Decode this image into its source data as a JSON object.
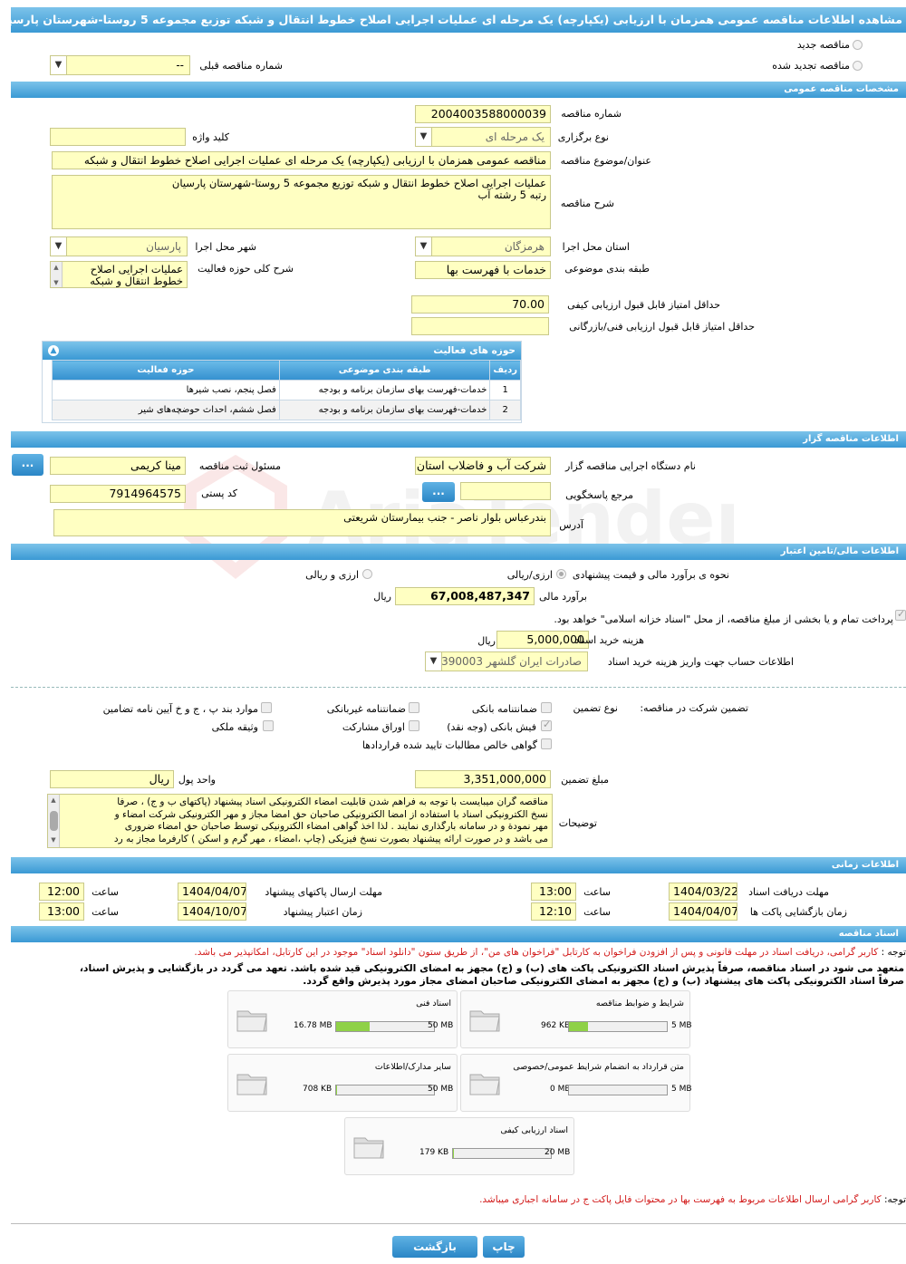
{
  "window_title": "مشاهده اطلاعات مناقصه عمومی همزمان با ارزیابی (یکپارچه) یک مرحله ای عملیات اجرایی اصلاح خطوط انتقال و شبکه توزیع مجموعه 5 روستا-شهرستان پارسیان",
  "top": {
    "new_tender": "مناقصه جدید",
    "renewed_tender": "مناقصه تجدید شده",
    "prev_tender_label": "شماره مناقصه قبلی",
    "prev_tender_value": "--"
  },
  "sections": {
    "general": "مشخصات مناقصه عمومی",
    "organizer": "اطلاعات مناقصه گزار",
    "financial": "اطلاعات مالی/تامین اعتبار",
    "timing": "اطلاعات زمانی",
    "documents": "اسناد مناقصه"
  },
  "general": {
    "tender_no_label": "شماره مناقصه",
    "tender_no": "2004003588000039",
    "type_label": "نوع برگزاری",
    "type": "یک مرحله ای",
    "keyword_label": "کلید واژه",
    "keyword": "",
    "subject_label": "عنوان/موضوع مناقصه",
    "subject": "مناقصه عمومی همزمان با ارزیابی (یکپارچه) یک مرحله ای عملیات اجرایی اصلاح خطوط انتقال و شبکه",
    "desc_label": "شرح مناقصه",
    "desc_line1": "عملیات اجرایی اصلاح خطوط انتقال و شبکه توزیع مجموعه 5 روستا-شهرستان پارسیان",
    "desc_line2": "رتبه 5 رشته آب",
    "province_label": "استان محل اجرا",
    "province": "هرمزگان",
    "city_label": "شهر محل اجرا",
    "city": "پارسیان",
    "category_label": "طبقه بندی موضوعی",
    "category": "خدمات با فهرست بها",
    "activity_label": "شرح کلی حوزه فعالیت",
    "activity_line1": "عملیات اجرایی اصلاح",
    "activity_line2": "خطوط انتقال و شبکه توزیع",
    "min_quality_label": "حداقل امتیاز قابل قبول ارزیابی کیفی",
    "min_quality": "70.00",
    "min_tech_label": "حداقل امتیاز قابل قبول ارزیابی فنی/بازرگانی",
    "min_tech": ""
  },
  "activity_table": {
    "title": "حوزه های فعالیت",
    "headers": [
      "ردیف",
      "طبقه بندی موضوعی",
      "حوزه فعالیت"
    ],
    "rows": [
      [
        "1",
        "خدمات-فهرست بهای سازمان برنامه و بودجه",
        "فصل پنجم، نصب شیرها"
      ],
      [
        "2",
        "خدمات-فهرست بهای سازمان برنامه و بودجه",
        "فصل ششم، احداث حوضچه‌های شیر"
      ]
    ]
  },
  "organizer": {
    "org_label": "نام دستگاه اجرایی مناقصه گزار",
    "org": "شرکت آب و فاضلاب استان",
    "registrar_label": "مسئول ثبت مناقصه",
    "registrar": "مینا کریمی",
    "ref_label": "مرجع پاسخگویی",
    "ref": "",
    "postal_label": "کد پستی",
    "postal": "7914964575",
    "address_label": "آدرس",
    "address": "بندرعباس بلوار ناصر - جنب بیمارستان شریعتی",
    "more_btn": "..."
  },
  "financial": {
    "estimate_type_label": "نحوه ی برآورد مالی و قیمت پیشنهادی",
    "opt_rial": "ارزی/ریالی",
    "opt_fx": "ارزی و ریالی",
    "estimate_label": "برآورد مالی",
    "estimate": "67,008,487,347",
    "unit_rial": "ریال",
    "treasury_text": "پرداخت تمام و یا بخشی از مبلغ مناقصه، از محل \"اسناد خزانه اسلامی\" خواهد بود.",
    "doc_fee_label": "هزینه خرید اسناد",
    "doc_fee": "5,000,000",
    "account_label": "اطلاعات حساب جهت واریز هزینه خرید اسناد",
    "account": "صادرات ایران گلشهر 390003"
  },
  "guarantee": {
    "label": "تضمین شرکت در مناقصه:",
    "type_label": "نوع تضمین",
    "opts": {
      "bank": "ضمانتنامه بانکی",
      "nonbank": "ضمانتنامه غیربانکی",
      "items": "موارد بند پ ، ج و خ آیین نامه تضامین",
      "cash": "فیش بانکی (وجه نقد)",
      "bonds": "اوراق مشارکت",
      "property": "وثیقه ملکی",
      "receivable": "گواهی خالص مطالبات تایید شده قراردادها"
    },
    "amount_label": "مبلغ تضمین",
    "amount": "3,351,000,000",
    "currency_label": "واحد پول",
    "currency": "ریال",
    "notes_label": "توضیحات",
    "notes": [
      "مناقصه گران میبایست با توجه به فراهم شدن قابلیت امضاء الکترونیکی اسناد پیشنهاد (پاکتهای ب و ج) ، صرفا",
      "نسخ الکترونیکی اسناد با استفاده از امضا الکترونیکی صاحبان حق امضا مجاز و مهر الکترونیکی شرکت امضاء و",
      "مهر نمودة و در سامانه بارگذاری نمایند . لذا اخذ گواهی امضاء الکترونیکی توسط صاحبان حق امضاء ضروری",
      "می باشد و در صورت ارائه پیشنهاد بصورت نسخ فیزیکی (چاپ ،امضاء ، مهر گرم و اسکن ) کارفرما مجاز به رد"
    ]
  },
  "timing": {
    "receive_label": "مهلت دریافت اسناد",
    "receive_date": "1404/03/22",
    "receive_time": "13:00",
    "submit_label": "مهلت ارسال پاکتهای پیشنهاد",
    "submit_date": "1404/04/07",
    "submit_time": "12:00",
    "open_label": "زمان بازگشایی پاکت ها",
    "open_date": "1404/04/07",
    "open_time": "12:10",
    "validity_label": "زمان اعتبار پیشنهاد",
    "validity_date": "1404/10/07",
    "validity_time": "13:00",
    "time_label": "ساعت"
  },
  "docs": {
    "note1_prefix": "توجه :",
    "note1": "کاربر گرامی، دریافت اسناد در مهلت قانونی و پس از افزودن فراخوان به کارتابل \"فراخوان های من\"، از طریق ستون \"دانلود اسناد\" موجود در این کارتابل، امکانپذیر می باشد.",
    "commit1": "متعهد می شود در اسناد مناقصه، صرفاً پذیرش اسناد الکترونیکی پاکت های (ب) و (ج) مجهز به امضای الکترونیکی قید شده باشد. تعهد می گردد در بازگشایی و پذیرش اسناد،",
    "commit2": "صرفاً اسناد الکترونیکی پاکت های پیشنهاد (ب) و (ج) مجهز به امضای الکترونیکی صاحبان امضای مجاز مورد پذیرش واقع گردد.",
    "cards": [
      {
        "title": "شرایط و ضوابط مناقصه",
        "used": "962 KB",
        "max": "5 MB",
        "pct": 19
      },
      {
        "title": "اسناد فنی",
        "used": "16.78 MB",
        "max": "50 MB",
        "pct": 34
      },
      {
        "title": "متن قرارداد به انضمام شرایط عمومی/خصوصی",
        "used": "0 MB",
        "max": "5 MB",
        "pct": 0
      },
      {
        "title": "سایر مدارک/اطلاعات",
        "used": "708 KB",
        "max": "50 MB",
        "pct": 1
      },
      {
        "title": "اسناد ارزیابی کیفی",
        "used": "179 KB",
        "max": "20 MB",
        "pct": 1
      }
    ],
    "note2_prefix": "توجه:",
    "note2": "کاربر گرامی ارسال اطلاعات مربوط به فهرست بها در محتوات فایل پاکت ج در سامانه اجباری میباشد."
  },
  "buttons": {
    "print": "چاپ",
    "back": "بازگشت"
  },
  "watermark": "AriaTender.neT",
  "colors": {
    "header": "#3a99d4",
    "field_bg": "#ffffc2",
    "red": "#d21b1b"
  }
}
